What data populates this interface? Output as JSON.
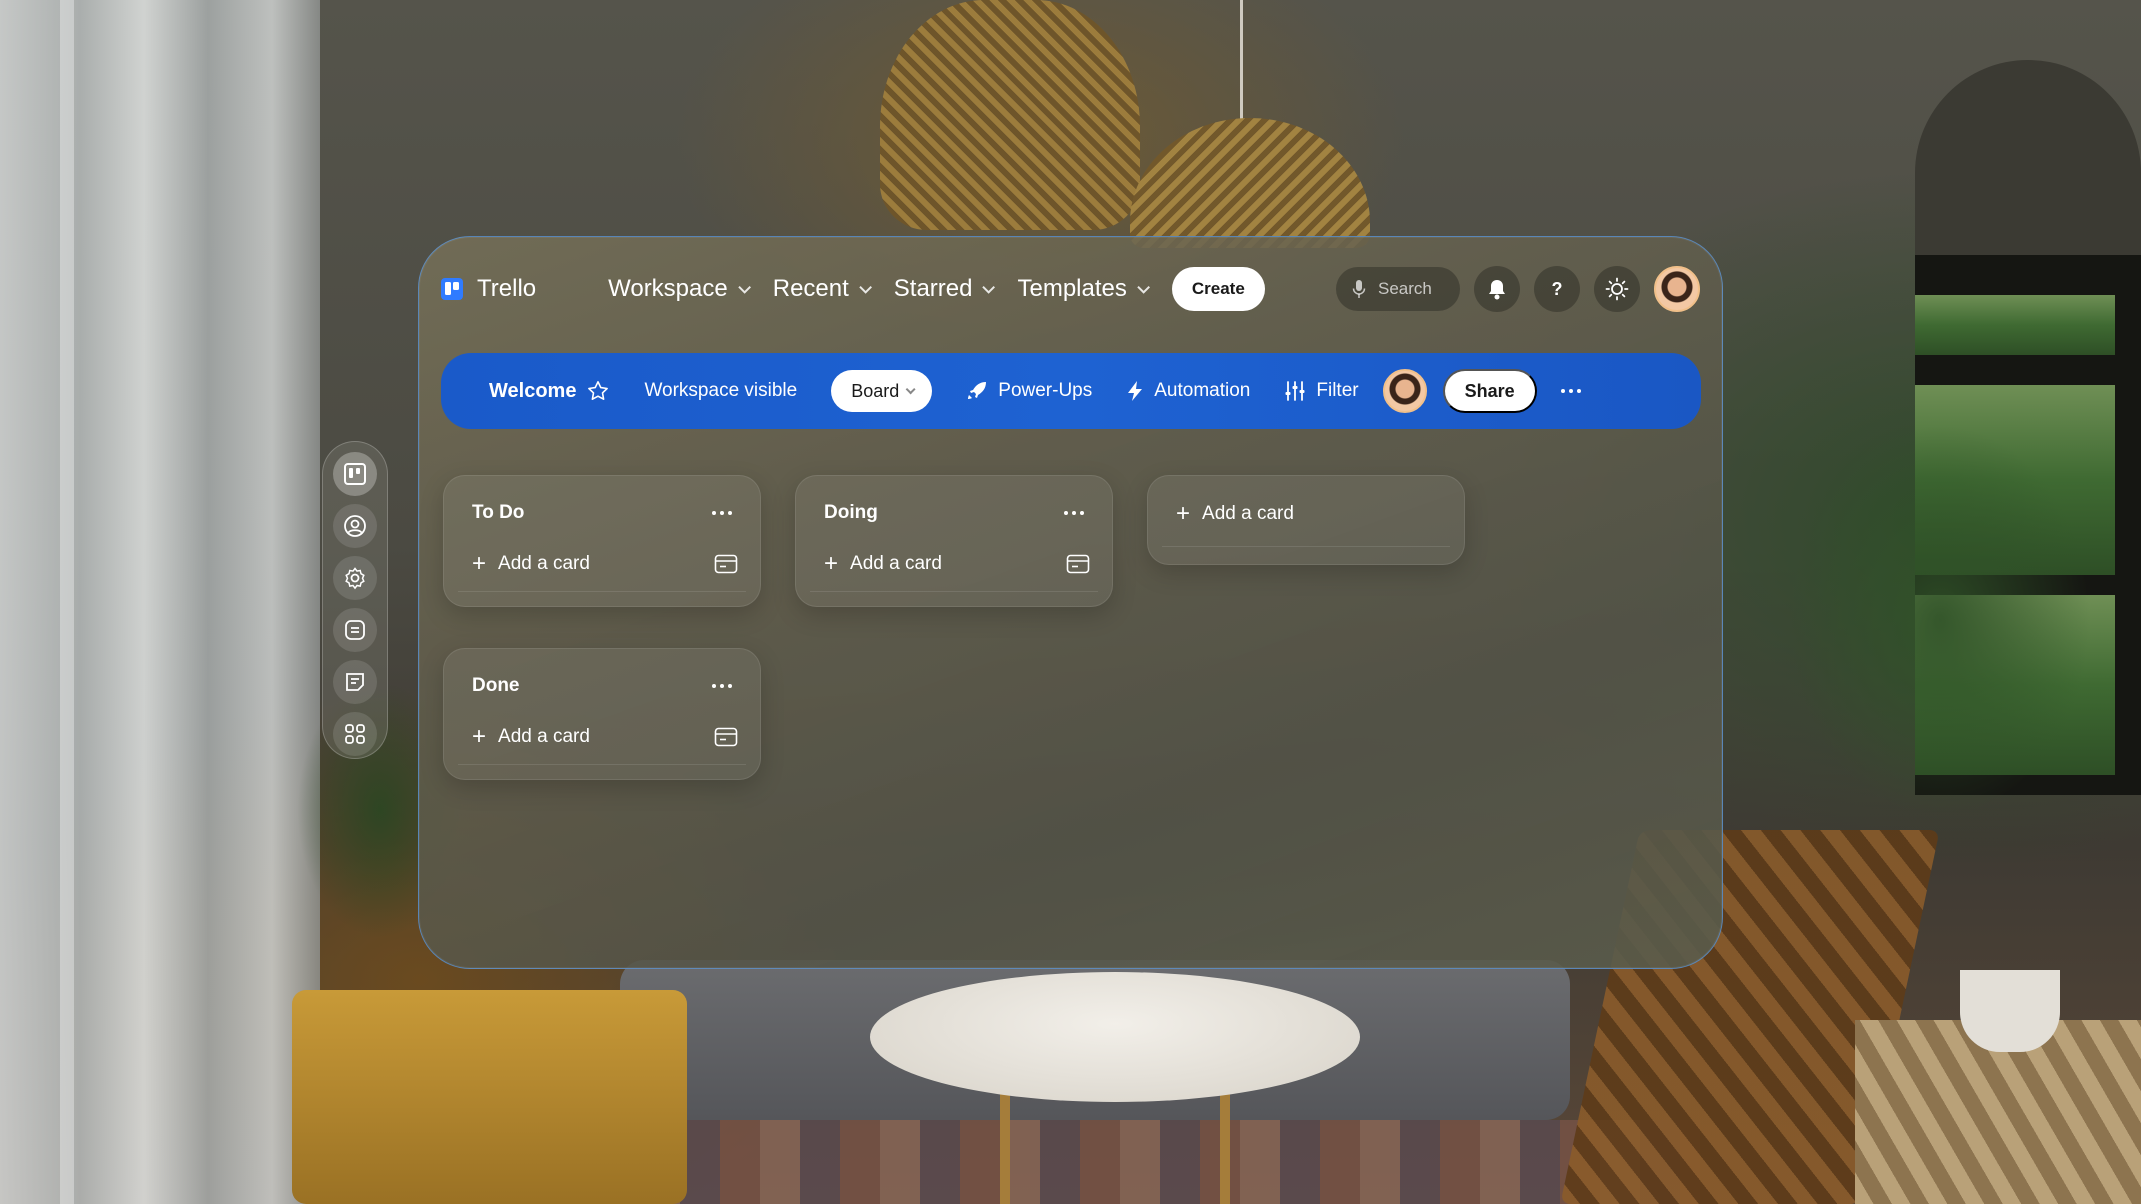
{
  "topbar": {
    "app_name": "Trello",
    "nav": [
      {
        "label": "Workspace"
      },
      {
        "label": "Recent"
      },
      {
        "label": "Starred"
      },
      {
        "label": "Templates"
      }
    ],
    "create_label": "Create",
    "search_placeholder": "Search",
    "help_label": "?"
  },
  "boardbar": {
    "title": "Welcome",
    "visibility": "Workspace visible",
    "view_label": "Board",
    "powerups_label": "Power-Ups",
    "automation_label": "Automation",
    "filter_label": "Filter",
    "share_label": "Share"
  },
  "lists": [
    {
      "title": "To Do",
      "add_label": "Add a card"
    },
    {
      "title": "Doing",
      "add_label": "Add a card"
    },
    {
      "title": "Done",
      "add_label": "Add a card"
    }
  ],
  "add_list": {
    "label": "Add a card"
  },
  "sidebar": {
    "icons": [
      "board-icon",
      "profile-icon",
      "settings-icon",
      "list-icon",
      "notes-icon",
      "apps-icon"
    ]
  },
  "colors": {
    "accent": "#1e62d2",
    "logo": "#2f7bff",
    "window_border": "#5a96dc"
  }
}
